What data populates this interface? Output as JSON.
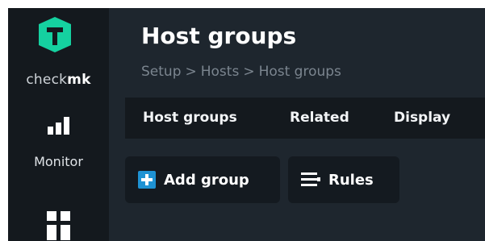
{
  "app": {
    "brand_light": "check",
    "brand_bold": "mk",
    "logo_icon": "checkmk-logo-icon",
    "accent_color": "#15d1a0"
  },
  "sidebar": {
    "items": [
      {
        "label": "Monitor",
        "icon": "bar-chart-icon"
      },
      {
        "label": "",
        "icon": "setup-grid-icon"
      }
    ]
  },
  "page": {
    "title": "Host groups",
    "breadcrumb": [
      "Setup",
      "Hosts",
      "Host groups"
    ],
    "breadcrumb_separator": ">"
  },
  "menubar": {
    "items": [
      "Host groups",
      "Related",
      "Display"
    ]
  },
  "toolbar": {
    "add_label": "Add group",
    "add_icon": "plus-icon",
    "add_icon_color": "#1e92d3",
    "rules_label": "Rules",
    "rules_icon": "rules-icon"
  }
}
